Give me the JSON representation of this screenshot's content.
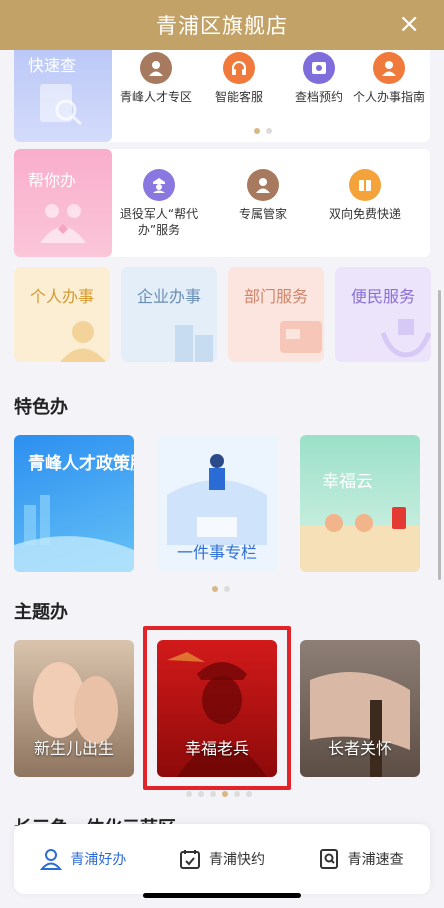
{
  "header": {
    "title": "青浦区旗舰店",
    "close_icon": "×"
  },
  "quick_check": {
    "label": "快速查",
    "services": [
      {
        "label": "青峰人才专区",
        "icon": "person-badge-icon",
        "color": "#a77a5f"
      },
      {
        "label": "智能客服",
        "icon": "headset-icon",
        "color": "#f07a3c"
      },
      {
        "label": "查档预约",
        "icon": "folder-search-icon",
        "color": "#7f6ddc"
      },
      {
        "label": "个人办事指南",
        "icon": "person-guide-icon",
        "color": "#f07a3c"
      }
    ]
  },
  "help": {
    "label": "帮你办",
    "services": [
      {
        "label": "退役军人“帮代办”服务",
        "icon": "veteran-icon",
        "color": "#8a78e0"
      },
      {
        "label": "专属管家",
        "icon": "butler-icon",
        "color": "#a77a5f"
      },
      {
        "label": "双向免费快递",
        "icon": "parcel-icon",
        "color": "#f4a23a"
      }
    ]
  },
  "categories": [
    {
      "label": "个人办事",
      "color": "#d49b33",
      "bg": "#fbeed3"
    },
    {
      "label": "企业办事",
      "color": "#6b8fb4",
      "bg": "#e3eef9"
    },
    {
      "label": "部门服务",
      "color": "#d1846a",
      "bg": "#fbe5de"
    },
    {
      "label": "便民服务",
      "color": "#8a6fd6",
      "bg": "#ebe4fb"
    }
  ],
  "featured": {
    "title": "特色办",
    "items": [
      {
        "label": "青峰人才政策服务"
      },
      {
        "label": "一件事专栏"
      },
      {
        "label": "幸福云"
      }
    ]
  },
  "themes": {
    "title": "主题办",
    "items": [
      {
        "label": "新生儿出生"
      },
      {
        "label": "幸福老兵"
      },
      {
        "label": "长者关怀"
      }
    ]
  },
  "partial_section_title": "长三角一体化示范区",
  "tabs": [
    {
      "label": "青浦好办",
      "icon": "user-icon",
      "active": true
    },
    {
      "label": "青浦快约",
      "icon": "calendar-check-icon",
      "active": false
    },
    {
      "label": "青浦速查",
      "icon": "search-doc-icon",
      "active": false
    }
  ]
}
